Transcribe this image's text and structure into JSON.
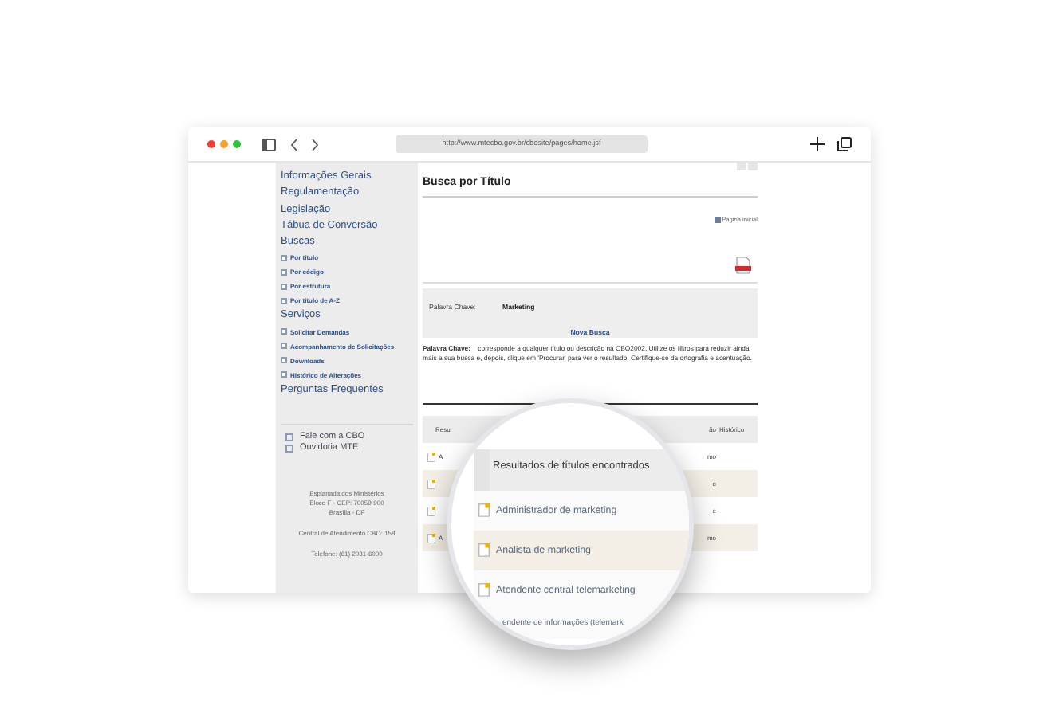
{
  "browser": {
    "url": "http://www.mtecbo.gov.br/cbosite/pages/home.jsf"
  },
  "sidebar": {
    "items": [
      {
        "label": "Informações Gerais",
        "kind": "main"
      },
      {
        "label": "Regulamentação",
        "kind": "main"
      },
      {
        "label": "Legislação",
        "kind": "main"
      },
      {
        "label": "Tábua de Conversão",
        "kind": "main"
      },
      {
        "label": "Buscas",
        "kind": "main"
      },
      {
        "label": "Por título",
        "kind": "sub"
      },
      {
        "label": "Por código",
        "kind": "sub"
      },
      {
        "label": "Por estrutura",
        "kind": "sub"
      },
      {
        "label": "Por título de A-Z",
        "kind": "sub"
      },
      {
        "label": "Serviços",
        "kind": "main"
      },
      {
        "label": "Solicitar Demandas",
        "kind": "sub"
      },
      {
        "label": "Acompanhamento de Solicitações",
        "kind": "sub"
      },
      {
        "label": "Downloads",
        "kind": "sub"
      },
      {
        "label": "Histórico de Alterações",
        "kind": "sub"
      },
      {
        "label": "Perguntas Frequentes",
        "kind": "main"
      }
    ],
    "contacts": [
      "Fale com a CBO",
      "Ouvidoria MTE"
    ],
    "address": [
      "Esplanada dos Ministérios",
      "Bloco F - CEP: 70059-900",
      "Brasília - DF"
    ],
    "service_center": "Central de Atendimento CBO: 158",
    "phone": "Telefone: (61) 2031-6000"
  },
  "main": {
    "title": "Busca por Título",
    "home_link": "Página inicial",
    "search_box": {
      "label": "Palavra Chave:",
      "value": "Marketing",
      "new_search": "Nova Busca"
    },
    "help": "**Palavra Chave:**    corresponde a qualquer título ou descrição na CBO2002. Utilize os filtros para reduzir ainda mais a sua busca e, depois, clique em 'Procurar' para ver o resultado. Certifique-se da ortografia e acentuação.",
    "table": {
      "columns": [
        "Resu",
        "ão",
        "Histórico"
      ],
      "rows": [
        {
          "column_1": "A",
          "column_2": "mo"
        },
        {
          "column_1": "",
          "column_2": "o"
        },
        {
          "column_1": "",
          "column_2": "e"
        },
        {
          "column_1": "A",
          "column_2": "mo"
        }
      ]
    }
  },
  "magnifier": {
    "header": "Resultados de títulos encontrados",
    "rows": [
      "Administrador de marketing",
      "Analista de marketing",
      "Atendente central telemarketing"
    ],
    "cut_row": "endente de informações (telemark"
  }
}
